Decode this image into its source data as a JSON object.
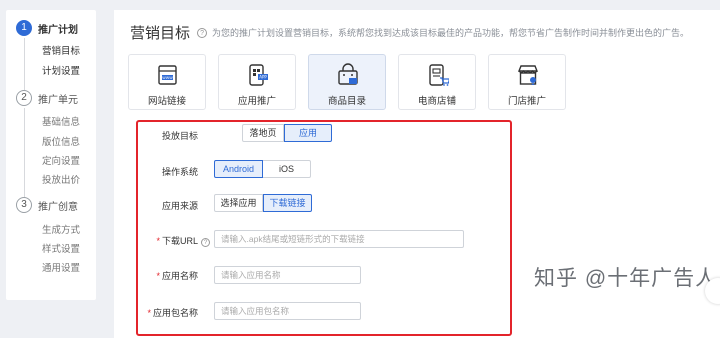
{
  "sidebar": {
    "steps": [
      {
        "num": "1",
        "label": "推广计划",
        "subs": [
          "营销目标",
          "计划设置"
        ]
      },
      {
        "num": "2",
        "label": "推广单元",
        "subs": [
          "基础信息",
          "版位信息",
          "定向设置",
          "投放出价"
        ]
      },
      {
        "num": "3",
        "label": "推广创意",
        "subs": [
          "生成方式",
          "样式设置",
          "通用设置"
        ]
      }
    ]
  },
  "main": {
    "title": "营销目标",
    "description": "为您的推广计划设置营销目标，系统帮您找到达成该目标最佳的产品功能，帮您节省广告制作时间并制作更出色的广告。",
    "cards": [
      {
        "label": "网站链接",
        "icon": "web-icon"
      },
      {
        "label": "应用推广",
        "icon": "app-icon"
      },
      {
        "label": "商品目录",
        "icon": "shopping-bag-icon"
      },
      {
        "label": "电商店铺",
        "icon": "ecommerce-store-icon"
      },
      {
        "label": "门店推广",
        "icon": "storefront-icon"
      }
    ],
    "form": {
      "target": {
        "label": "投放目标",
        "options": [
          "落地页",
          "应用"
        ],
        "selected": "应用"
      },
      "os": {
        "label": "操作系统",
        "options": [
          "Android",
          "iOS"
        ],
        "selected": "Android"
      },
      "source": {
        "label": "应用来源",
        "options": [
          "选择应用",
          "下载链接"
        ],
        "selected": "下载链接"
      },
      "download_url": {
        "label": "下载URL",
        "placeholder": "请输入.apk结尾或短链形式的下载链接"
      },
      "app_name": {
        "label": "应用名称",
        "placeholder": "请输入应用名称"
      },
      "package_name": {
        "label": "应用包名称",
        "placeholder": "请输入应用包名称"
      }
    }
  },
  "watermark": "知乎 @十年广告人",
  "colors": {
    "accent": "#2f6bd6",
    "highlight_box": "#e3242b"
  }
}
